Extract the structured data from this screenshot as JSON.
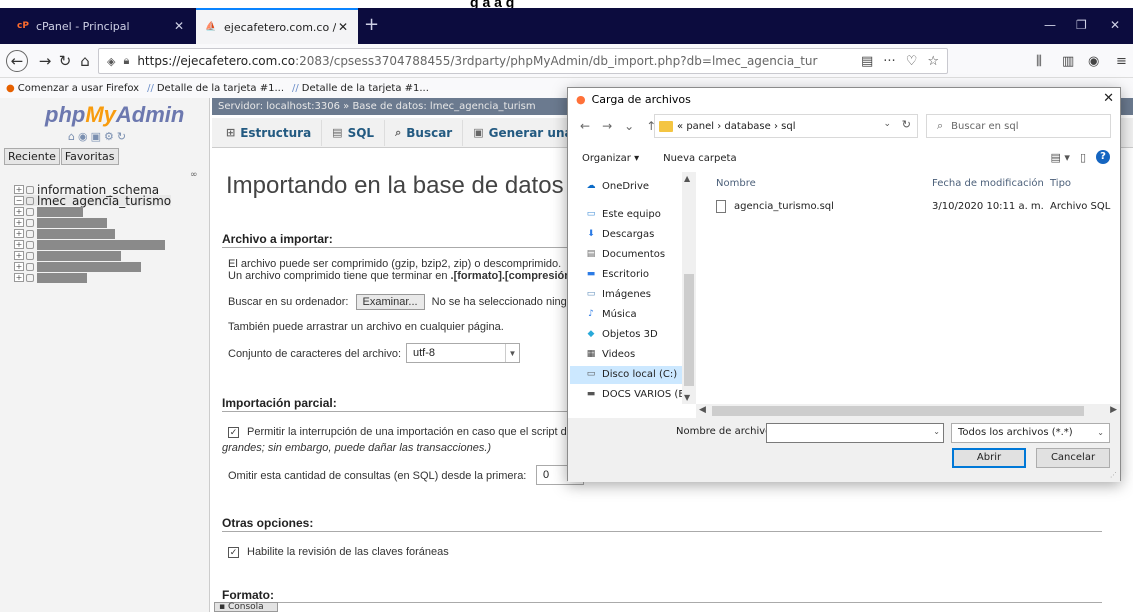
{
  "page_fragment": "g  a  a  g",
  "browser": {
    "tabs": [
      {
        "title": "cPanel - Principal",
        "favicon": "cP"
      },
      {
        "title": "ejecafetero.com.co / localhost",
        "favicon": "phpmyadmin-icon"
      }
    ],
    "url_host": "https://ejecafetero.com.co",
    "url_path": ":2083/cpsess3704788455/3rdparty/phpMyAdmin/db_import.php?db=lmec_agencia_tur",
    "bookmarks": [
      "Comenzar a usar Firefox",
      "Detalle de la tarjeta #1...",
      "Detalle de la tarjeta #1..."
    ]
  },
  "pma": {
    "logo": {
      "php": "php",
      "my": "My",
      "admin": "Admin"
    },
    "left_tabs": [
      "Reciente",
      "Favoritas"
    ],
    "databases": [
      "information_schema",
      "lmec_agencia_turismo"
    ],
    "blurred_db_widths": [
      46,
      70,
      78,
      128,
      84,
      104,
      50
    ],
    "breadcrumb": "Servidor: localhost:3306 » Base de datos: lmec_agencia_turism",
    "menu": [
      "Estructura",
      "SQL",
      "Buscar",
      "Generar una cons"
    ],
    "title": "Importando en la base de datos \"Im",
    "sec_import": "Archivo a importar:",
    "import_line1": "El archivo puede ser comprimido (gzip, bzip2, zip) o descomprimido.",
    "import_line2_a": "Un archivo comprimido tiene que terminar en ",
    "import_line2_b": ".[formato].[compresión]",
    "browse_label": "Buscar en su ordenador:",
    "browse_button": "Examinar...",
    "browse_none": "No se ha seleccionado ningú",
    "drag_text": "También puede arrastrar un archivo en cualquier página.",
    "charset_label": "Conjunto de caracteres del archivo:",
    "charset_value": "utf-8",
    "sec_partial": "Importación parcial:",
    "partial_check": "Permitir la interrupción de una importación en caso que el script d",
    "partial_note": "grandes; sin embargo, puede dañar las transacciones.)",
    "skip_label": "Omitir esta cantidad de consultas (en SQL) desde la primera:",
    "skip_value": "0",
    "sec_other": "Otras opciones:",
    "fk_check": "Habilite la revisión de las claves foráneas",
    "sec_format": "Formato:",
    "console": "Consola"
  },
  "dialog": {
    "title": "Carga de archivos",
    "path": [
      "«",
      "panel",
      "database",
      "sql"
    ],
    "search_placeholder": "Buscar en sql",
    "organize": "Organizar ▾",
    "new_folder": "Nueva carpeta",
    "nav_items": [
      "OneDrive",
      "Este equipo",
      "Descargas",
      "Documentos",
      "Escritorio",
      "Imágenes",
      "Música",
      "Objetos 3D",
      "Videos",
      "Disco local (C:)",
      "DOCS VARIOS (E"
    ],
    "selected_nav": "Disco local (C:)",
    "columns": [
      "Nombre",
      "Fecha de modificación",
      "Tipo"
    ],
    "files": [
      {
        "name": "agencia_turismo.sql",
        "date": "3/10/2020 10:11 a. m.",
        "type": "Archivo SQL"
      }
    ],
    "filename_label": "Nombre de archivo:",
    "filename_value": "",
    "filetype": "Todos los archivos (*.*)",
    "open_button": "Abrir",
    "cancel_button": "Cancelar"
  }
}
